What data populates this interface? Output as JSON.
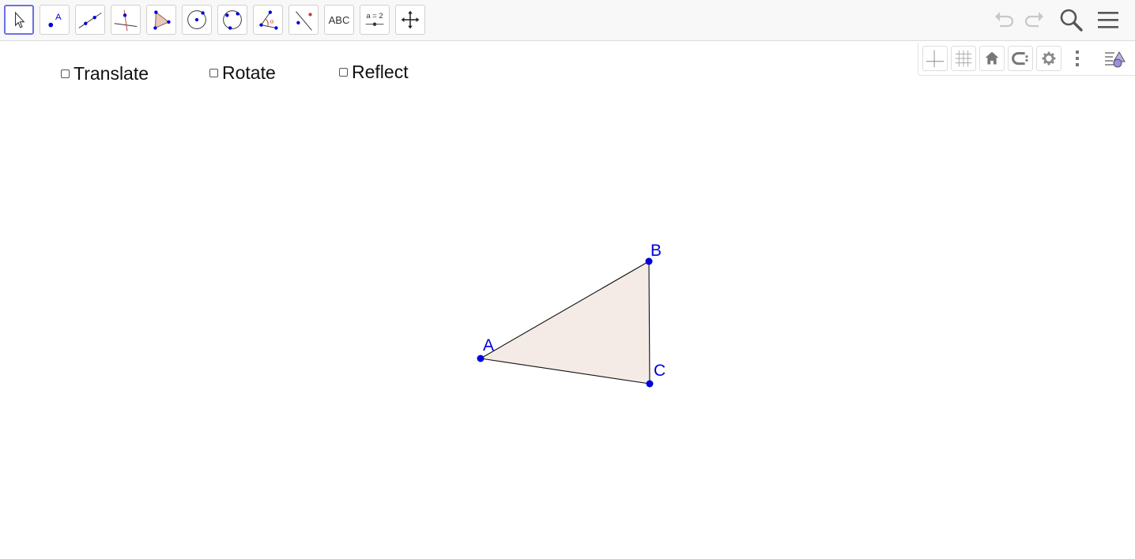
{
  "toolbar": {
    "tools": [
      {
        "name": "move-tool",
        "icon": "pointer-arrow-icon",
        "selected": true
      },
      {
        "name": "point-tool",
        "icon": "point-icon",
        "icon_label": "A"
      },
      {
        "name": "line-tool",
        "icon": "line-through-points-icon"
      },
      {
        "name": "perpendicular-line-tool",
        "icon": "perpendicular-line-icon"
      },
      {
        "name": "polygon-tool",
        "icon": "polygon-icon"
      },
      {
        "name": "circle-tool",
        "icon": "circle-center-point-icon"
      },
      {
        "name": "circle-three-points-tool",
        "icon": "circle-three-points-icon"
      },
      {
        "name": "angle-tool",
        "icon": "angle-icon",
        "icon_label": "α"
      },
      {
        "name": "reflect-tool",
        "icon": "reflect-about-line-icon"
      },
      {
        "name": "text-tool",
        "icon": "text-icon",
        "label": "ABC"
      },
      {
        "name": "slider-tool",
        "icon": "slider-icon",
        "label": "a = 2"
      },
      {
        "name": "move-graphics-tool",
        "icon": "move-graphics-view-icon"
      }
    ],
    "undo_icon": "undo-icon",
    "redo_icon": "redo-icon",
    "search_icon": "search-icon",
    "menu_icon": "hamburger-menu-icon"
  },
  "style_bar": {
    "buttons": [
      "axes-icon",
      "grid-icon",
      "home-icon",
      "point-capturing-icon",
      "gear-icon",
      "more-vertical-icon",
      "toggle-style-bar-icon"
    ]
  },
  "checkboxes": [
    {
      "label": "Translate",
      "checked": false
    },
    {
      "label": "Rotate",
      "checked": false
    },
    {
      "label": "Reflect",
      "checked": false
    }
  ],
  "graphics": {
    "triangle_fill": "#f4ebe6",
    "point_color": "#0000d8",
    "points": [
      {
        "label": "A"
      },
      {
        "label": "B"
      },
      {
        "label": "C"
      }
    ]
  },
  "colors": {
    "selected_tool_border": "#6c70e0",
    "point_blue": "#0000d8",
    "icon_gray": "#666666"
  }
}
